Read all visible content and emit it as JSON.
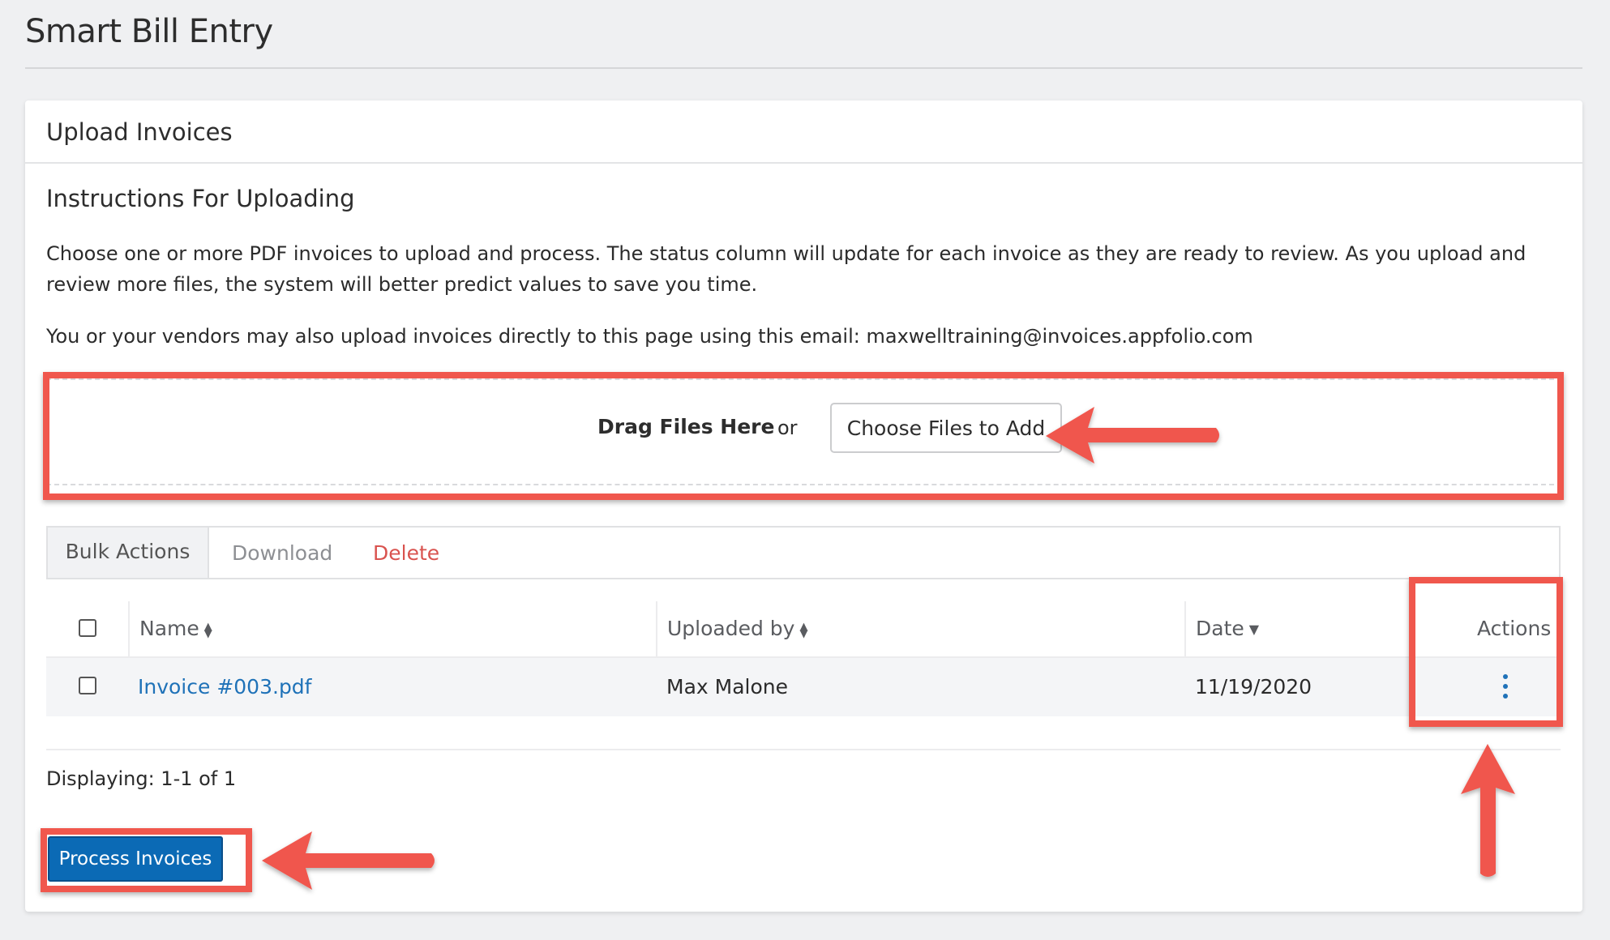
{
  "page": {
    "title": "Smart Bill Entry"
  },
  "card": {
    "header": "Upload Invoices",
    "instructions_title": "Instructions For Uploading",
    "instructions_text": "Choose one or more PDF invoices to upload and process. The status column will update for each invoice as they are ready to review. As you upload and review more files, the system will better predict values to save you time.",
    "email_text": "You or your vendors may also upload invoices directly to this page using this email: maxwelltraining@invoices.appfolio.com"
  },
  "dropzone": {
    "drag_label": "Drag Files Here",
    "or_label": "or",
    "choose_button": "Choose Files to Add"
  },
  "bulk_actions": {
    "tab_label": "Bulk Actions",
    "download_label": "Download",
    "delete_label": "Delete"
  },
  "table": {
    "columns": {
      "name": "Name",
      "uploaded_by": "Uploaded by",
      "date": "Date",
      "actions": "Actions"
    },
    "rows": [
      {
        "name": "Invoice #003.pdf",
        "uploaded_by": "Max Malone",
        "date": "11/19/2020"
      }
    ]
  },
  "footer": {
    "displaying": "Displaying: 1-1 of 1",
    "process_button": "Process Invoices"
  },
  "icons": {
    "sort": "sort-updown-icon",
    "sort_desc": "caret-down-icon",
    "row_actions": "kebab-vertical-icon"
  },
  "colors": {
    "primary": "#0b6ab5",
    "link": "#1f72b8",
    "danger": "#d9534f",
    "annotation": "#f0574d"
  }
}
